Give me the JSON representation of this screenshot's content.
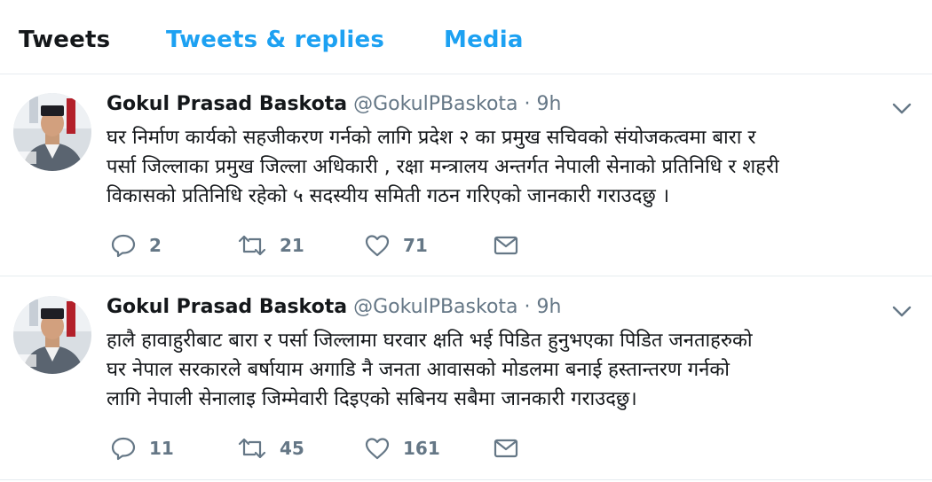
{
  "tabs": [
    {
      "label": "Tweets",
      "active": true
    },
    {
      "label": "Tweets & replies",
      "active": false
    },
    {
      "label": "Media",
      "active": false
    }
  ],
  "colors": {
    "accent": "#1da1f2",
    "muted": "#657786",
    "text": "#14171a",
    "divider": "#e6ecf0"
  },
  "tweets": [
    {
      "name": "Gokul Prasad Baskota",
      "handle": "@GokulPBaskota",
      "separator": "·",
      "time": "9h",
      "lines": [
        "घर निर्माण कार्यको सहजीकरण गर्नको लागि प्रदेश २ का प्रमुख सचिवको संयोजकत्वमा  बारा र",
        "पर्सा जिल्लाका प्रमुख जिल्ला अधिकारी , रक्षा मन्त्रालय अन्तर्गत नेपाली सेनाको प्रतिनिधि र शहरी",
        "विकासको प्रतिनिधि रहेको ५ सदस्यीय समिती गठन गरिएको जानकारी गराउदछु ।"
      ],
      "replies": "2",
      "retweets": "21",
      "likes": "71",
      "icons": [
        "reply-icon",
        "retweet-icon",
        "like-icon",
        "direct-message-icon",
        "caret-down-icon"
      ]
    },
    {
      "name": "Gokul Prasad Baskota",
      "handle": "@GokulPBaskota",
      "separator": "·",
      "time": "9h",
      "lines": [
        "हालै हावाहुरीबाट  बारा र पर्सा जिल्लामा घरवार क्षति भई पिडित हुनुभएका पिडित जनताहरुको",
        "घर नेपाल सरकारले बर्षायाम अगाडि नै जनता आवासको मोडलमा बनाई  हस्तान्तरण गर्नको",
        "लागि  नेपाली सेनालाइ जिम्मेवारी दिइएको सबिनय सबैमा जानकारी गराउदछु।"
      ],
      "replies": "11",
      "retweets": "45",
      "likes": "161",
      "icons": [
        "reply-icon",
        "retweet-icon",
        "like-icon",
        "direct-message-icon",
        "caret-down-icon"
      ]
    }
  ]
}
